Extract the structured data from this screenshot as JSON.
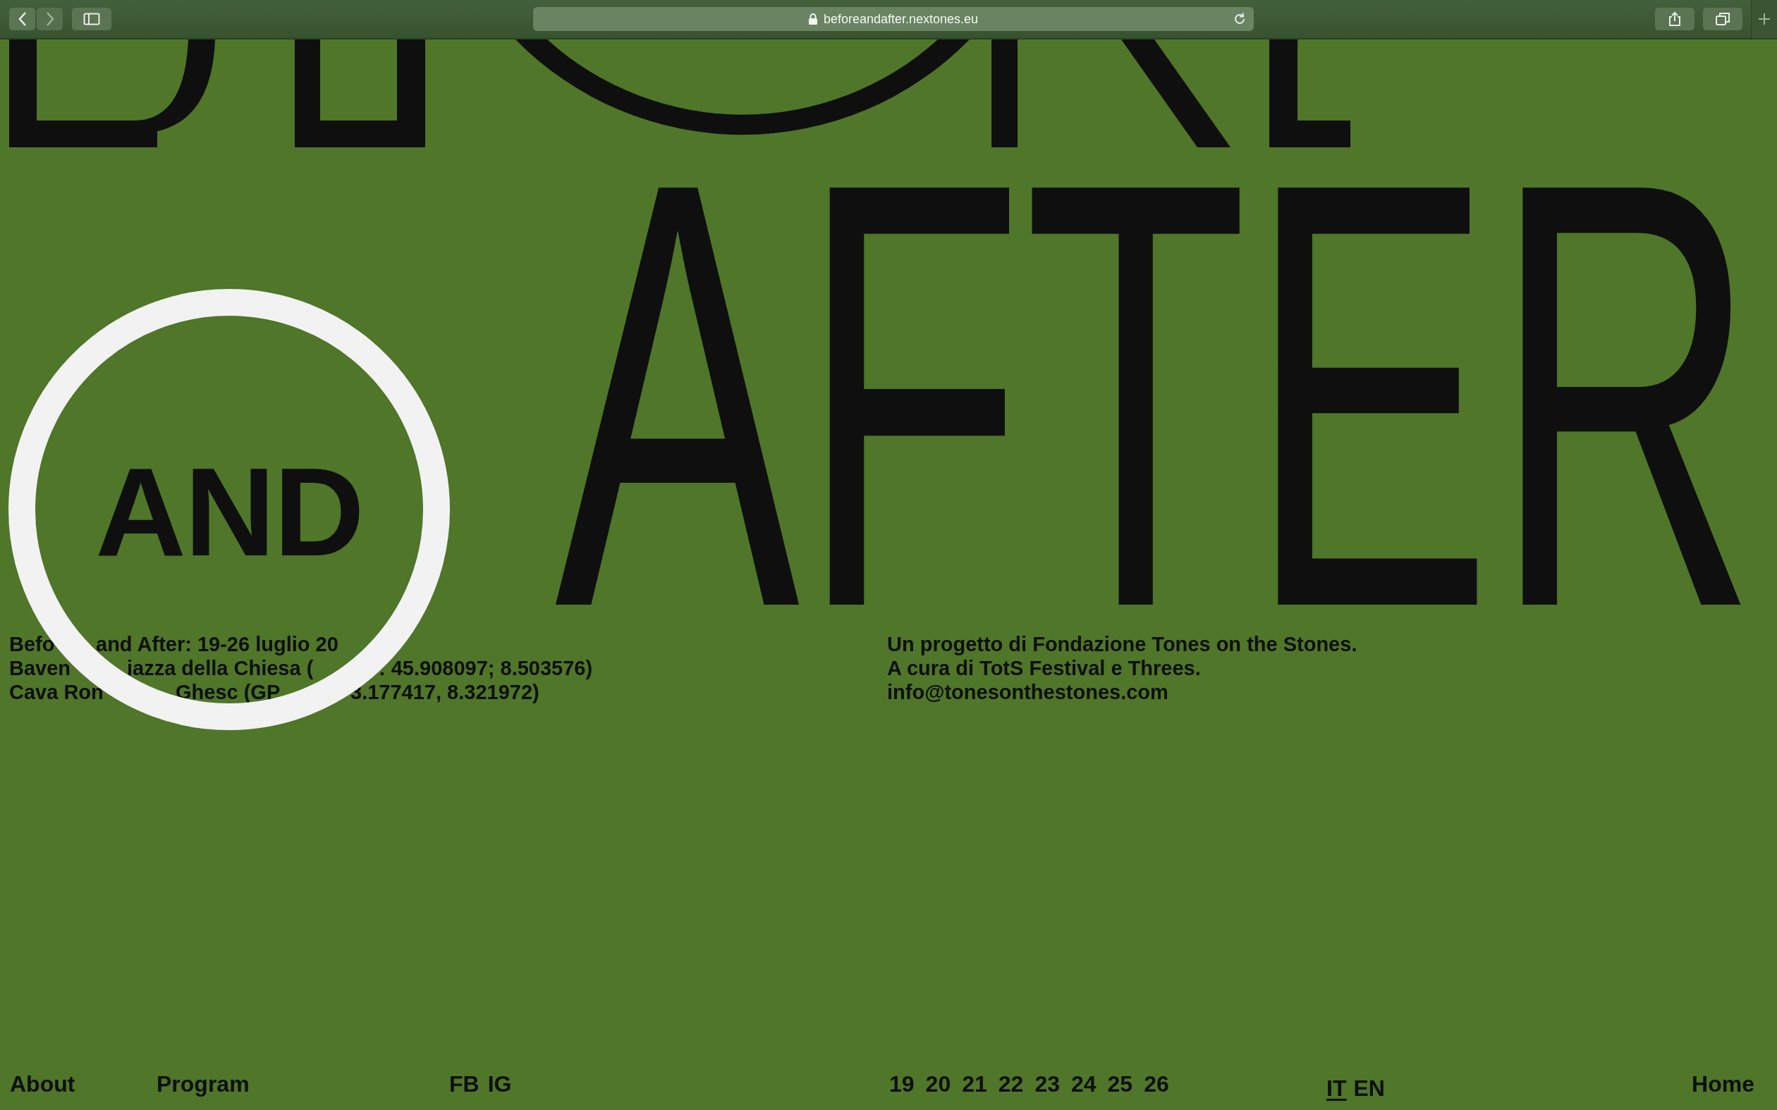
{
  "browser": {
    "url": "beforeandafter.nextones.eu"
  },
  "hero": {
    "wordmark": "AFTER",
    "badge": "AND"
  },
  "info_left": [
    {
      "fragments": [
        "Befo",
        "and After: 19-26 luglio 20"
      ]
    },
    {
      "fragments": [
        "Baven",
        "iazza della Chiesa (",
        ": 45.908097; 8.503576)"
      ]
    },
    {
      "fragments": [
        "Cava Ron",
        "Ghesc (GP",
        "3.177417, 8.321972)"
      ]
    }
  ],
  "info_right": [
    "Un progetto di Fondazione Tones on the Stones.",
    "A cura di TotS Festival e Threes.",
    "info@tonesonthestones.com"
  ],
  "footer": {
    "nav": [
      {
        "label": "About"
      },
      {
        "label": "Program"
      }
    ],
    "social": [
      {
        "label": "FB"
      },
      {
        "label": "IG"
      }
    ],
    "dates": [
      {
        "label": "19"
      },
      {
        "label": "20"
      },
      {
        "label": "21"
      },
      {
        "label": "22"
      },
      {
        "label": "23"
      },
      {
        "label": "24"
      },
      {
        "label": "25"
      },
      {
        "label": "26"
      }
    ],
    "languages": [
      {
        "label": "IT",
        "selected": true
      },
      {
        "label": "EN",
        "selected": false
      }
    ],
    "home": "Home"
  }
}
